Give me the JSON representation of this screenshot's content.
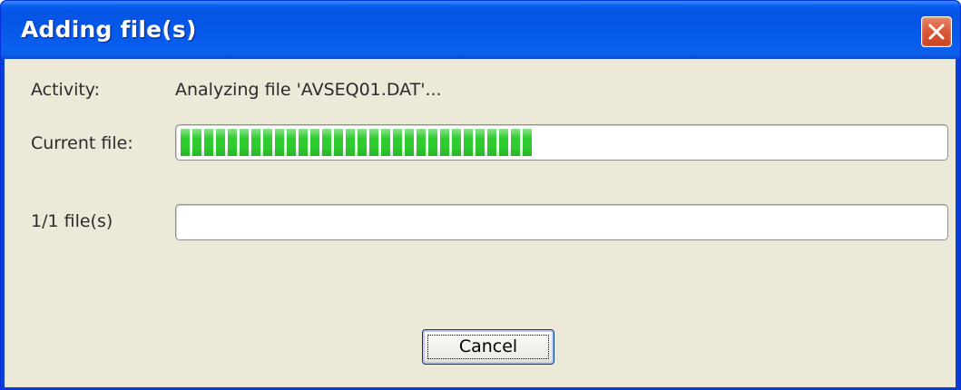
{
  "window": {
    "title": "Adding file(s)",
    "close_icon": "close-icon"
  },
  "activity": {
    "label": "Activity:",
    "value": "Analyzing file 'AVSEQ01.DAT'..."
  },
  "current_file": {
    "label": "Current file:",
    "progress": 0.46
  },
  "total_files": {
    "label": "1/1 file(s)",
    "progress": 0.0
  },
  "buttons": {
    "cancel_label": "Cancel"
  },
  "colors": {
    "titlebar": "#0554e6",
    "client_background": "#ece9d8",
    "progress_fill": "#2fcc2f",
    "close_button": "#dd5a3a"
  }
}
